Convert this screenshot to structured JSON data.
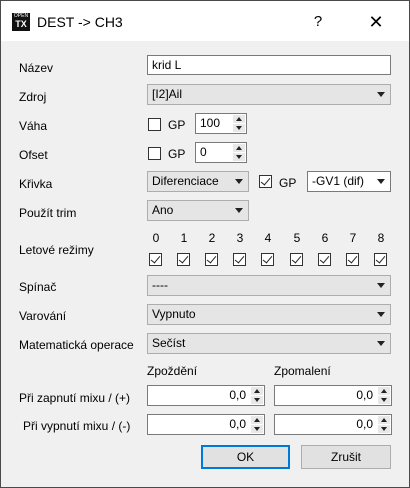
{
  "window": {
    "title": "DEST -> CH3",
    "help_label": "?",
    "close_label": "✕",
    "icon": {
      "line1": "OPEN",
      "line2": "TX"
    }
  },
  "form": {
    "name_label": "Název",
    "name_value": "krid L",
    "source_label": "Zdroj",
    "source_value": "[I2]Ail",
    "weight_label": "Váha",
    "weight_gp": "GP",
    "weight_value": "100",
    "offset_label": "Ofset",
    "offset_gp": "GP",
    "offset_value": "0",
    "curve_label": "Křivka",
    "curve_type": "Diferenciace",
    "curve_gp": "GP",
    "curve_value": "-GV1 (dif)",
    "trim_label": "Použít trim",
    "trim_value": "Ano",
    "flight_modes_label": "Letové režimy",
    "flight_modes": [
      "0",
      "1",
      "2",
      "3",
      "4",
      "5",
      "6",
      "7",
      "8"
    ],
    "switch_label": "Spínač",
    "switch_value": "----",
    "warning_label": "Varování",
    "warning_value": "Vypnuto",
    "math_label": "Matematická operace",
    "math_value": "Sečíst",
    "delay_header": "Zpoždění",
    "slow_header": "Zpomalení",
    "mix_on_label": "Při zapnutí mixu / (+)",
    "mix_off_label": "Při vypnutí mixu / (-)",
    "delay_up": "0,0",
    "delay_down": "0,0",
    "slow_up": "0,0",
    "slow_down": "0,0"
  },
  "buttons": {
    "ok": "OK",
    "cancel": "Zrušit"
  }
}
